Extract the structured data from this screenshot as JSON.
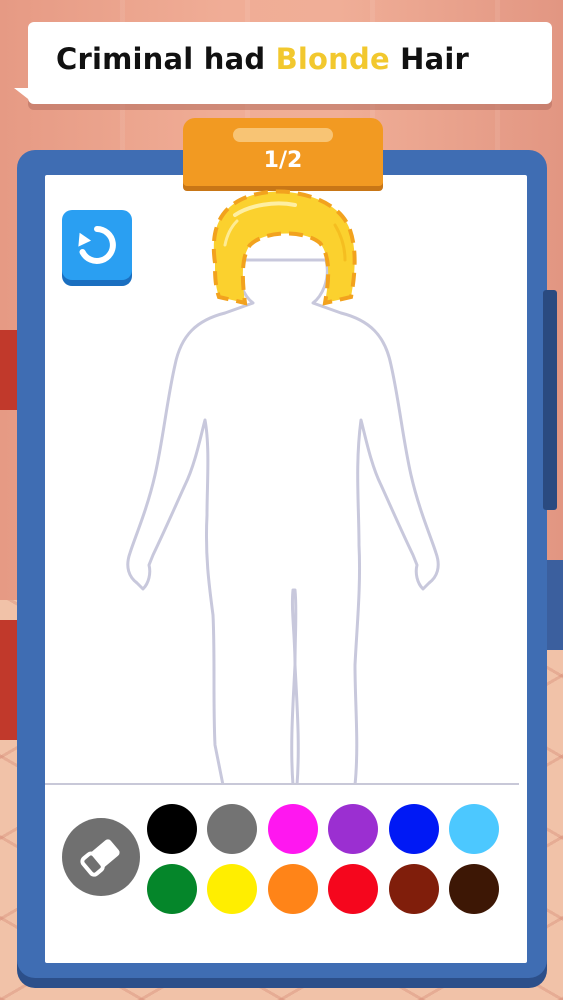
{
  "prompt": {
    "prefix": "Criminal had ",
    "highlight": "Blonde",
    "suffix": " Hair",
    "highlight_color": "#f2c82e"
  },
  "progress": {
    "label": "1/2"
  },
  "icons": {
    "reset": "undo-rotate-icon",
    "eraser": "eraser-icon"
  },
  "palette": [
    {
      "name": "black",
      "color": "#000000"
    },
    {
      "name": "gray",
      "color": "#737373"
    },
    {
      "name": "magenta",
      "color": "#ff17f0"
    },
    {
      "name": "purple",
      "color": "#9b2fd1"
    },
    {
      "name": "blue",
      "color": "#0019f5"
    },
    {
      "name": "light-blue",
      "color": "#4cc8ff"
    },
    {
      "name": "green",
      "color": "#05862a"
    },
    {
      "name": "yellow",
      "color": "#ffee00"
    },
    {
      "name": "orange",
      "color": "#ff8418"
    },
    {
      "name": "red",
      "color": "#f5061d"
    },
    {
      "name": "dark-red",
      "color": "#801e0b"
    },
    {
      "name": "dark-brown",
      "color": "#3d1705"
    }
  ],
  "colors": {
    "board": "#3f6db3",
    "clip": "#f29a22",
    "hair": "#fbd12e",
    "hair_outline": "#f2a21e",
    "body_outline": "#c8c8dc"
  }
}
